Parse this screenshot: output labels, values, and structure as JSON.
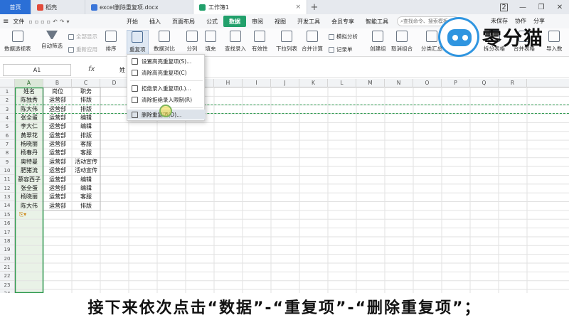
{
  "tabs": {
    "home": "首页",
    "doc1": "稻壳",
    "doc2": "excel删除重复项.docx",
    "sheet": "工作簿1",
    "badge": "2"
  },
  "menu": {
    "file": "文件",
    "items": [
      "开始",
      "插入",
      "页面布局",
      "公式",
      "数据",
      "审阅",
      "视图",
      "开发工具",
      "会员专享",
      "智能工具"
    ],
    "active_index": 4,
    "search_placeholder": "查找命令、搜索模板",
    "save_label": "未保存",
    "collab_label": "协作",
    "share_label": "分享"
  },
  "ribbon": {
    "pivot": "数据透视表",
    "autofilter": "自动筛选",
    "show_all": "全部显示",
    "reapply": "重新应用",
    "sort": "排序",
    "duplicates": "重复项",
    "compare": "数据对比",
    "split": "分列",
    "fill": "填充",
    "lookup": "查找录入",
    "validity": "有效性",
    "dropdown_list": "下拉列表",
    "consolidate": "合并计算",
    "simulate": "模拟分析",
    "record": "记录单",
    "group": "创建组",
    "ungroup": "取消组合",
    "subtotal": "分类汇总",
    "split_table": "拆分表格",
    "merge_table": "合并表格",
    "import": "导入数"
  },
  "formula_bar": {
    "cell_ref": "A1",
    "fx": "fx",
    "value": "姓"
  },
  "columns": [
    "A",
    "B",
    "C",
    "D",
    "E",
    "F",
    "G",
    "H",
    "I",
    "J",
    "K",
    "L",
    "M",
    "N",
    "O",
    "P",
    "Q",
    "R"
  ],
  "rows": [
    "1",
    "2",
    "3",
    "4",
    "5",
    "6",
    "7",
    "8",
    "9",
    "10",
    "11",
    "12",
    "13",
    "14",
    "15",
    "16",
    "17",
    "18",
    "19",
    "20",
    "21",
    "22",
    "23",
    "24"
  ],
  "table": {
    "headers": [
      "姓名",
      "岗位",
      "职务"
    ],
    "data": [
      [
        "陈独秀",
        "运营部",
        "排版"
      ],
      [
        "陈大伟",
        "运营部",
        "排版"
      ],
      [
        "张全蛋",
        "运营部",
        "编辑"
      ],
      [
        "李大仁",
        "运营部",
        "编辑"
      ],
      [
        "黄翠花",
        "运营部",
        "排版"
      ],
      [
        "杨晓丽",
        "运营部",
        "客服"
      ],
      [
        "杨春丹",
        "运营部",
        "客服"
      ],
      [
        "奥特曼",
        "运营部",
        "活动宣传"
      ],
      [
        "肥猪流",
        "运营部",
        "活动宣传"
      ],
      [
        "慕容西子",
        "运营部",
        "编辑"
      ],
      [
        "张全蛋",
        "运营部",
        "编辑"
      ],
      [
        "杨晓丽",
        "运营部",
        "客服"
      ],
      [
        "陈大伟",
        "运营部",
        "排版"
      ]
    ]
  },
  "dropdown": {
    "items": [
      "设置高亮重复项(S)...",
      "清除高亮重复项(C)",
      "拒绝录入重复项(L)...",
      "清除拒绝录入限制(R)",
      "删除重复项(D)..."
    ],
    "hover_index": 4
  },
  "logo": {
    "text": "零分猫"
  },
  "caption": "接下来依次点击“数据”-“重复项”-“删除重复项”；",
  "colors": {
    "accent": "#22a06b",
    "home_tab": "#2b6fd6",
    "selection": "#e3efe1",
    "logo_blue": "#2f95e0"
  }
}
